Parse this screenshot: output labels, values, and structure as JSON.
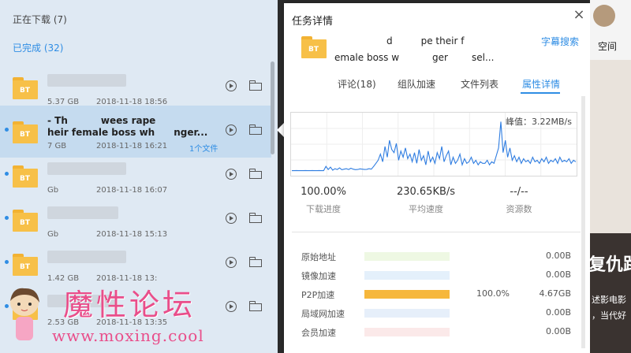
{
  "list": {
    "downloading_header": "正在下载 (7)",
    "completed_header": "已完成 (32)",
    "items": [
      {
        "name": "",
        "size": "5.37 GB",
        "date": "2018-11-18 18:56",
        "files": "",
        "selected": false,
        "bullet": false
      },
      {
        "name": "- Th       wees rape\nheir female boss wh    nger...",
        "size": "7 GB",
        "date": "2018-11-18 16:21",
        "files": "1个文件",
        "selected": true,
        "bullet": true
      },
      {
        "name": "",
        "size": "Gb",
        "date": "2018-11-18 16:07",
        "files": "",
        "selected": false,
        "bullet": true
      },
      {
        "name": "",
        "size": "Gb",
        "date": "2018-11-18 15:13",
        "files": "",
        "selected": false,
        "bullet": true
      },
      {
        "name": "",
        "size": "1.42 GB",
        "date": "2018-11-18 13:",
        "files": "",
        "selected": false,
        "bullet": true
      },
      {
        "name": "",
        "size": "2.53 GB",
        "date": "2018-11-18 13:35",
        "files": "",
        "selected": false,
        "bullet": true
      }
    ],
    "folder_badge": "BT"
  },
  "watermark": {
    "title": "魔性论坛",
    "url": "www.moxing.cool"
  },
  "panel": {
    "title": "任务详情",
    "close_glyph": "×",
    "task_name_line1": "           d      pe their f",
    "task_name_line2": "emale boss w       ger     sel...",
    "subtitle_search": "字幕搜索",
    "tabs": [
      "评论(18)",
      "组队加速",
      "文件列表",
      "属性详情"
    ],
    "active_tab": 3,
    "peak_label": "峰值：3.22MB/s",
    "stats": [
      {
        "value": "100.00%",
        "label": "下载进度"
      },
      {
        "value": "230.65KB/s",
        "label": "平均速度"
      },
      {
        "value": "--/--",
        "label": "资源数"
      }
    ],
    "accel": [
      {
        "label": "原始地址",
        "pct": "",
        "amount": "0.00B",
        "fill": 0,
        "color": "#eef8e3"
      },
      {
        "label": "镜像加速",
        "pct": "",
        "amount": "0.00B",
        "fill": 0,
        "color": "#e4f0fb"
      },
      {
        "label": "P2P加速",
        "pct": "100.0%",
        "amount": "4.67GB",
        "fill": 1.0,
        "color": "#f6b73c"
      },
      {
        "label": "局域网加速",
        "pct": "",
        "amount": "0.00B",
        "fill": 0,
        "color": "#e6effa"
      },
      {
        "label": "会员加速",
        "pct": "",
        "amount": "0.00B",
        "fill": 0,
        "color": "#fbe9e9"
      }
    ]
  },
  "chart_data": {
    "type": "line",
    "title": "",
    "peak": "3.22MB/s",
    "values": [
      0.02,
      0.02,
      0.03,
      0.02,
      0.02,
      0.02,
      0.03,
      0.02,
      0.02,
      0.03,
      0.02,
      0.02,
      0.03,
      0.02,
      0.02,
      0.3,
      0.1,
      0.25,
      0.05,
      0.15,
      0.1,
      0.2,
      0.08,
      0.12,
      0.15,
      0.1,
      0.18,
      0.12,
      0.09,
      0.1,
      0.14,
      0.12,
      0.1,
      0.11,
      0.15,
      0.12,
      0.3,
      0.5,
      0.7,
      1.1,
      0.6,
      1.6,
      0.9,
      2.0,
      1.4,
      1.2,
      1.8,
      0.7,
      1.3,
      0.9,
      1.5,
      0.8,
      1.1,
      0.6,
      1.2,
      0.5,
      1.4,
      0.7,
      1.0,
      0.4,
      1.3,
      0.6,
      0.9,
      0.5,
      1.2,
      0.8,
      1.6,
      0.6,
      1.0,
      1.3,
      0.4,
      0.9,
      0.5,
      0.7,
      1.1,
      0.4,
      0.8,
      0.5,
      0.6,
      0.9,
      0.5,
      0.7,
      0.4,
      0.6,
      0.5,
      0.5,
      0.7,
      0.4,
      0.6,
      0.5,
      1.0,
      1.5,
      3.22,
      1.2,
      2.0,
      0.9,
      1.5,
      0.7,
      1.0,
      0.6,
      0.9,
      0.5,
      0.8,
      0.6,
      0.7,
      0.5,
      0.9,
      0.6,
      0.7,
      0.5,
      0.8,
      0.6,
      0.9,
      0.5,
      0.7,
      0.6,
      0.8,
      0.5,
      0.9,
      0.6,
      0.7,
      0.6,
      0.8,
      0.5,
      0.7,
      0.6
    ],
    "ylim": [
      0,
      3.6
    ],
    "grid": true
  },
  "background": {
    "space_label": "空间",
    "headline": "复仇路",
    "line1": "述影电影",
    "line2": "，当代好"
  }
}
